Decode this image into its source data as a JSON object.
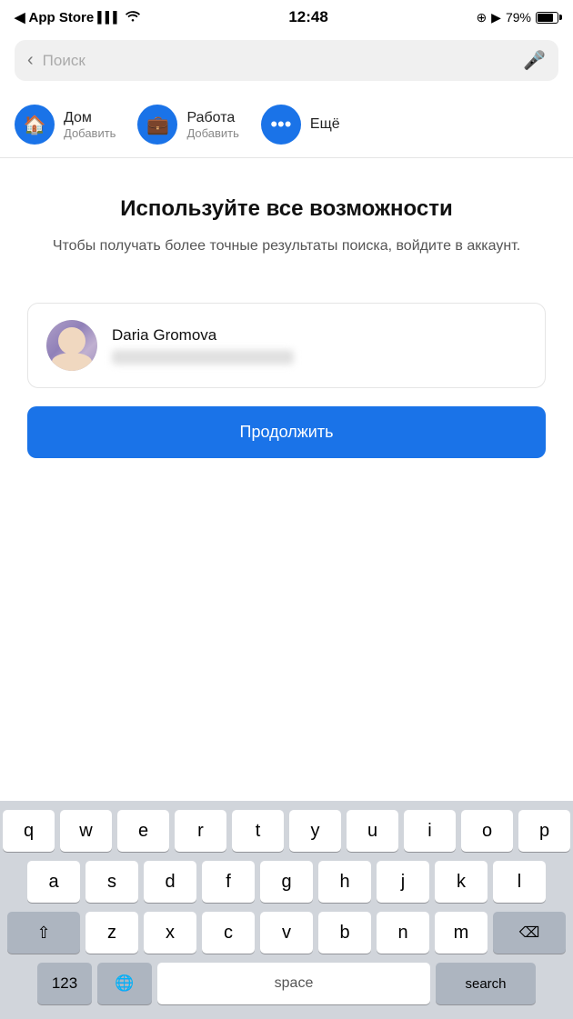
{
  "statusBar": {
    "carrier": "App Store",
    "signalBars": "▌▌▌",
    "wifi": "wifi",
    "time": "12:48",
    "locationIcon": "⊕",
    "battery": "79%"
  },
  "searchBar": {
    "backLabel": "‹",
    "placeholder": "Поиск",
    "micLabel": "🎤"
  },
  "quickAccess": {
    "items": [
      {
        "icon": "🏠",
        "title": "Дом",
        "sub": "Добавить"
      },
      {
        "icon": "💼",
        "title": "Работа",
        "sub": "Добавить"
      },
      {
        "icon": "•••",
        "title": "Ещё",
        "sub": ""
      }
    ]
  },
  "promo": {
    "title": "Используйте все возможности",
    "description": "Чтобы получать более точные результаты поиска, войдите в аккаунт."
  },
  "userCard": {
    "name": "Daria Gromova",
    "emailBlur": true
  },
  "continueBtn": {
    "label": "Продолжить"
  },
  "keyboard": {
    "row1": [
      "q",
      "w",
      "e",
      "r",
      "t",
      "y",
      "u",
      "i",
      "o",
      "p"
    ],
    "row2": [
      "a",
      "s",
      "d",
      "f",
      "g",
      "h",
      "j",
      "k",
      "l"
    ],
    "row3": [
      "z",
      "x",
      "c",
      "v",
      "b",
      "n",
      "m"
    ],
    "shiftLabel": "⇧",
    "deleteLabel": "⌫",
    "numLabel": "123",
    "globeLabel": "🌐",
    "spaceLabel": "space",
    "searchLabel": "search"
  }
}
